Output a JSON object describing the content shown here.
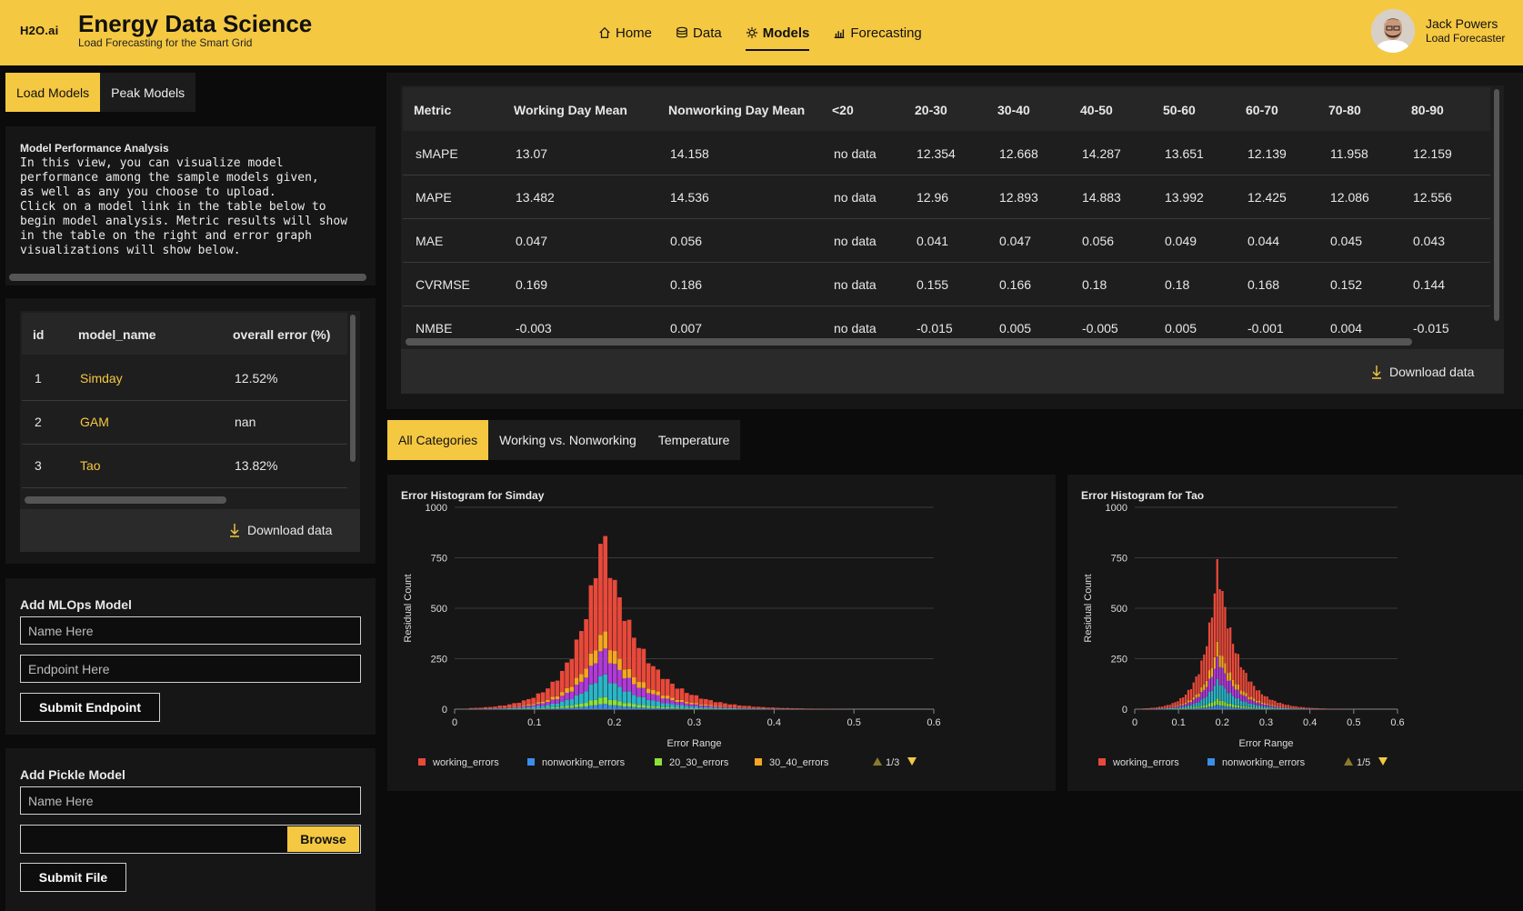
{
  "header": {
    "logo": "H2O.ai",
    "title": "Energy Data Science",
    "subtitle": "Load Forecasting for the Smart Grid",
    "nav": [
      {
        "label": "Home",
        "icon": "home-icon"
      },
      {
        "label": "Data",
        "icon": "database-icon"
      },
      {
        "label": "Models",
        "icon": "model-icon",
        "active": true
      },
      {
        "label": "Forecasting",
        "icon": "chart-icon"
      }
    ],
    "user": {
      "name": "Jack Powers",
      "role": "Load Forecaster"
    }
  },
  "model_tabs": [
    "Load Models",
    "Peak Models"
  ],
  "intro": {
    "title": "Model Performance Analysis",
    "text": "In this view, you can visualize model\nperformance among the sample models given,\nas well as any you choose to upload.\nClick on a model link in the table below to\nbegin model analysis. Metric results will show\nin the table on the right and error graph\nvisualizations will show below."
  },
  "models_table": {
    "columns": [
      "id",
      "model_name",
      "overall error (%)"
    ],
    "rows": [
      {
        "id": "1",
        "name": "Simday",
        "error": "12.52%"
      },
      {
        "id": "2",
        "name": "GAM",
        "error": "nan"
      },
      {
        "id": "3",
        "name": "Tao",
        "error": "13.82%"
      }
    ],
    "download_label": "Download data"
  },
  "mlops_form": {
    "title": "Add MLOps Model",
    "name_placeholder": "Name Here",
    "endpoint_placeholder": "Endpoint Here",
    "submit_label": "Submit Endpoint"
  },
  "pickle_form": {
    "title": "Add Pickle Model",
    "name_placeholder": "Name Here",
    "browse_label": "Browse",
    "submit_label": "Submit File"
  },
  "metrics_table": {
    "columns": [
      "Metric",
      "Working Day Mean",
      "Nonworking Day Mean",
      "<20",
      "20-30",
      "30-40",
      "40-50",
      "50-60",
      "60-70",
      "70-80",
      "80-90"
    ],
    "rows": [
      [
        "sMAPE",
        "13.07",
        "14.158",
        "no data",
        "12.354",
        "12.668",
        "14.287",
        "13.651",
        "12.139",
        "11.958",
        "12.159"
      ],
      [
        "MAPE",
        "13.482",
        "14.536",
        "no data",
        "12.96",
        "12.893",
        "14.883",
        "13.992",
        "12.425",
        "12.086",
        "12.556"
      ],
      [
        "MAE",
        "0.047",
        "0.056",
        "no data",
        "0.041",
        "0.047",
        "0.056",
        "0.049",
        "0.044",
        "0.045",
        "0.043"
      ],
      [
        "CVRMSE",
        "0.169",
        "0.186",
        "no data",
        "0.155",
        "0.166",
        "0.18",
        "0.18",
        "0.168",
        "0.152",
        "0.144"
      ],
      [
        "NMBE",
        "-0.003",
        "0.007",
        "no data",
        "-0.015",
        "0.005",
        "-0.005",
        "0.005",
        "-0.001",
        "0.004",
        "-0.015"
      ]
    ],
    "download_label": "Download data"
  },
  "chart_tabs": [
    "All Categories",
    "Working vs. Nonworking",
    "Temperature"
  ],
  "colors": {
    "accent": "#f5c842",
    "working": "#e8493a",
    "nonworking": "#3a8ee8",
    "e20_30": "#8ee03a",
    "e30_40": "#f5a623",
    "purple": "#b03ad8",
    "teal": "#2bb5c8"
  },
  "chart_data": [
    {
      "type": "bar",
      "title": "Error Histogram for Simday",
      "xlabel": "Error Range",
      "ylabel": "Residual Count",
      "xlim": [
        0,
        0.6
      ],
      "ylim": [
        0,
        1000
      ],
      "xticks": [
        "0",
        "0.1",
        "0.2",
        "0.3",
        "0.4",
        "0.5",
        "0.6"
      ],
      "yticks": [
        "0",
        "250",
        "500",
        "750",
        "1000"
      ],
      "peak_x": 0.185,
      "peak_total": 880,
      "legend": [
        "working_errors",
        "nonworking_errors",
        "20_30_errors",
        "30_40_errors"
      ],
      "legend_page": "1/3",
      "stack_fractions": {
        "working": 0.55,
        "orange": 0.1,
        "purple": 0.15,
        "teal": 0.13,
        "green": 0.04,
        "blue": 0.03
      }
    },
    {
      "type": "bar",
      "title": "Error Histogram for Tao",
      "xlabel": "Error Range",
      "ylabel": "Residual Count",
      "xlim": [
        0,
        0.6
      ],
      "ylim": [
        0,
        1000
      ],
      "xticks": [
        "0",
        "0.1",
        "0.2",
        "0.3",
        "0.4",
        "0.5",
        "0.6"
      ],
      "yticks": [
        "0",
        "250",
        "500",
        "750",
        "1000"
      ],
      "peak_x": 0.19,
      "peak_total": 720,
      "legend": [
        "working_errors",
        "nonworking_errors"
      ],
      "legend_page": "1/5",
      "stack_fractions": {
        "working": 0.55,
        "orange": 0.1,
        "purple": 0.15,
        "teal": 0.13,
        "green": 0.04,
        "blue": 0.03
      }
    }
  ]
}
